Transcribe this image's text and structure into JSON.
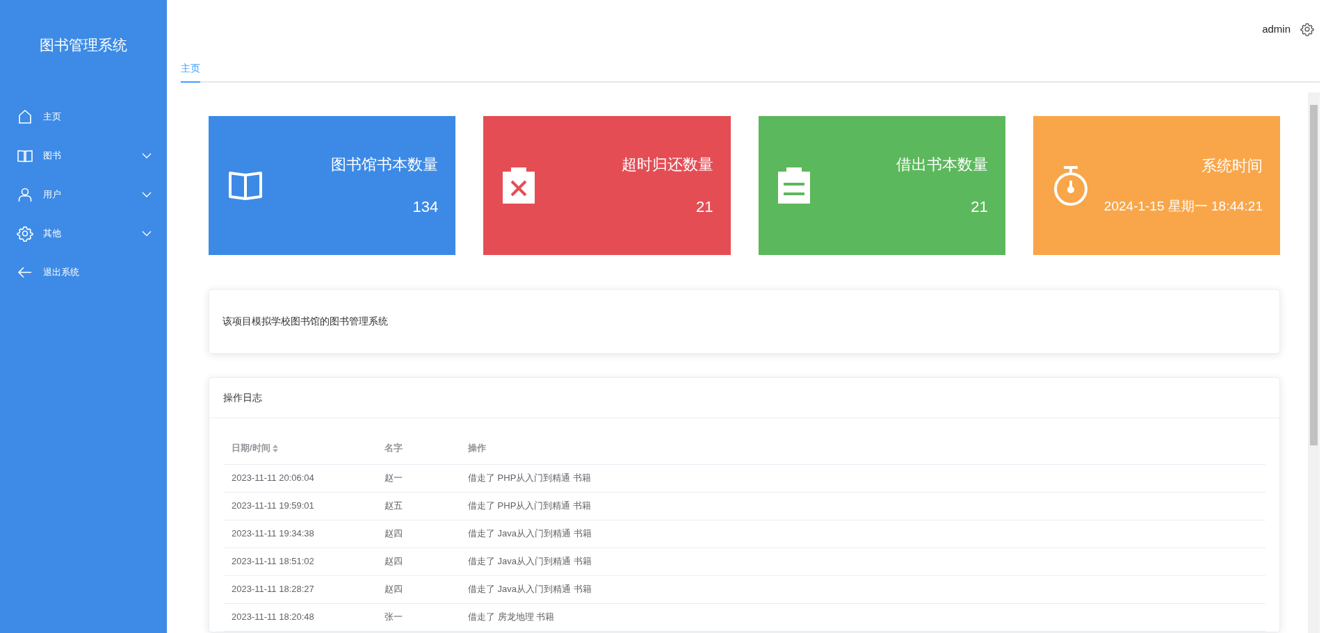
{
  "sidebar": {
    "title": "图书管理系统",
    "items": [
      {
        "label": "主页",
        "kind": "link"
      },
      {
        "label": "图书",
        "kind": "submenu"
      },
      {
        "label": "用户",
        "kind": "submenu"
      },
      {
        "label": "其他",
        "kind": "submenu"
      },
      {
        "label": "退出系统",
        "kind": "link"
      }
    ]
  },
  "header": {
    "user": "admin"
  },
  "tabs": [
    {
      "label": "主页",
      "selected": true
    }
  ],
  "stat_cards": [
    {
      "title": "图书馆书本数量",
      "value": "134",
      "color": "#3c8ae6",
      "kind": "book"
    },
    {
      "title": "超时归还数量",
      "value": "21",
      "color": "#e54d55",
      "kind": "overdue"
    },
    {
      "title": "借出书本数量",
      "value": "21",
      "color": "#5cb85c",
      "kind": "borrowed"
    },
    {
      "title": "系统时间",
      "value": "2024-1-15 星期一 18:44:21",
      "color": "#f9a64a",
      "kind": "clock"
    }
  ],
  "intro": {
    "text": "该项目模拟学校图书馆的图书管理系统"
  },
  "log": {
    "title": "操作日志",
    "columns": [
      {
        "label": "日期/时间",
        "sortable": true
      },
      {
        "label": "名字",
        "sortable": false
      },
      {
        "label": "操作",
        "sortable": false
      }
    ],
    "rows": [
      [
        "2023-11-11 20:06:04",
        "赵一",
        "借走了 PHP从入门到精通 书籍"
      ],
      [
        "2023-11-11 19:59:01",
        "赵五",
        "借走了 PHP从入门到精通 书籍"
      ],
      [
        "2023-11-11 19:34:38",
        "赵四",
        "借走了 Java从入门到精通 书籍"
      ],
      [
        "2023-11-11 18:51:02",
        "赵四",
        "借走了 Java从入门到精通 书籍"
      ],
      [
        "2023-11-11 18:28:27",
        "赵四",
        "借走了 Java从入门到精通 书籍"
      ],
      [
        "2023-11-11 18:20:48",
        "张一",
        "借走了 房龙地理 书籍"
      ]
    ]
  }
}
